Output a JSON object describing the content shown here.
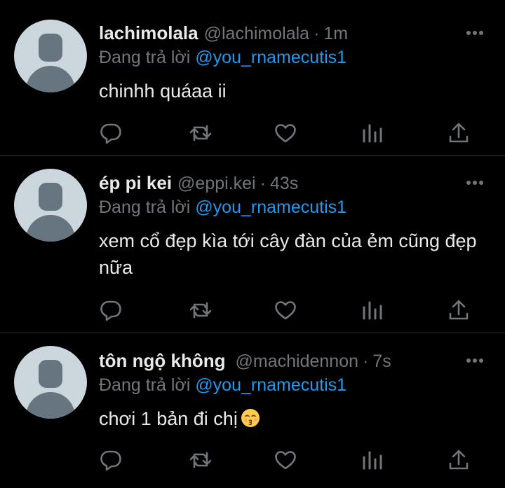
{
  "reply_prefix": "Đang trả lời ",
  "separator": "·",
  "tweets": [
    {
      "display_name": "lachimolala",
      "handle": "@lachimolala",
      "time": "1m",
      "reply_to": "@you_rnamecutis1",
      "text": "chinhh quáaa ii"
    },
    {
      "display_name": "ép pi kei",
      "handle": "@eppi.kei",
      "time": "43s",
      "reply_to": "@you_rnamecutis1",
      "text": "xem cổ đẹp kìa tới cây đàn của ẻm cũng đẹp nữa"
    },
    {
      "display_name": "tôn ngộ không",
      "handle": "@machidennon",
      "time": "7s",
      "reply_to": "@you_rnamecutis1",
      "text": "chơi 1 bản đi chị"
    }
  ],
  "icons": {
    "reply": "reply-icon",
    "retweet": "retweet-icon",
    "like": "heart-icon",
    "views": "analytics-icon",
    "share": "share-icon",
    "more": "more-icon",
    "emoji": "kissing-face-emoji-icon"
  },
  "colors": {
    "background": "#000000",
    "text": "#e7e9ea",
    "muted": "#71767b",
    "mention": "#1d9bf0",
    "divider": "#2f3336"
  }
}
